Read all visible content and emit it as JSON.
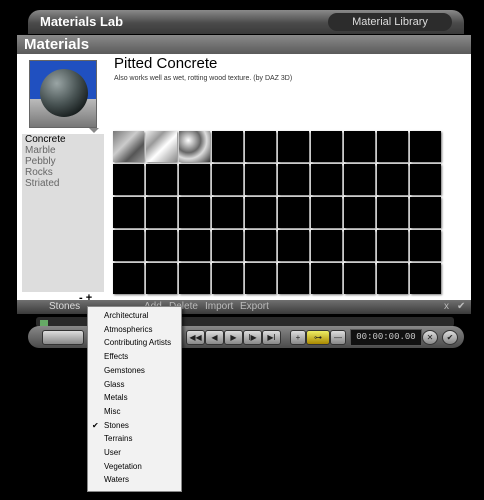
{
  "app_title": "Materials Lab",
  "library_label": "Material Library",
  "panel_title": "Materials",
  "material": {
    "name": "Pitted Concrete",
    "description": "Also works well as wet, rotting wood texture. (by DAZ 3D)"
  },
  "categories": [
    "Concrete",
    "Marble",
    "Pebbly",
    "Rocks",
    "Striated"
  ],
  "active_category": "Concrete",
  "list_controls": "- +",
  "thumbnails": {
    "filled": [
      "concrete",
      "marble",
      "pebbly"
    ],
    "total_cells": 50
  },
  "lower_bar": {
    "selector": "Stones",
    "add": "Add",
    "delete": "Delete",
    "import": "Import",
    "export": "Export",
    "cancel": "x",
    "confirm": "✔"
  },
  "playback": {
    "buttons": [
      "◀◀",
      "◀",
      "▶",
      "I▶",
      "▶I"
    ],
    "timecode": "00:00:00.00",
    "plus": "+",
    "minus": "—",
    "key": "⊶",
    "close": "✕",
    "ok": "✔"
  },
  "dropdown": {
    "items": [
      "Architectural",
      "Atmospherics",
      "Contributing Artists",
      "Effects",
      "Gemstones",
      "Glass",
      "Metals",
      "Misc",
      "Stones",
      "Terrains",
      "User",
      "Vegetation",
      "Waters"
    ],
    "checked": "Stones",
    "check_mark": "✔"
  },
  "colors": {
    "preview_bg": "#2050c0",
    "panel_bg": "#ffffff",
    "cell": "#000000"
  }
}
